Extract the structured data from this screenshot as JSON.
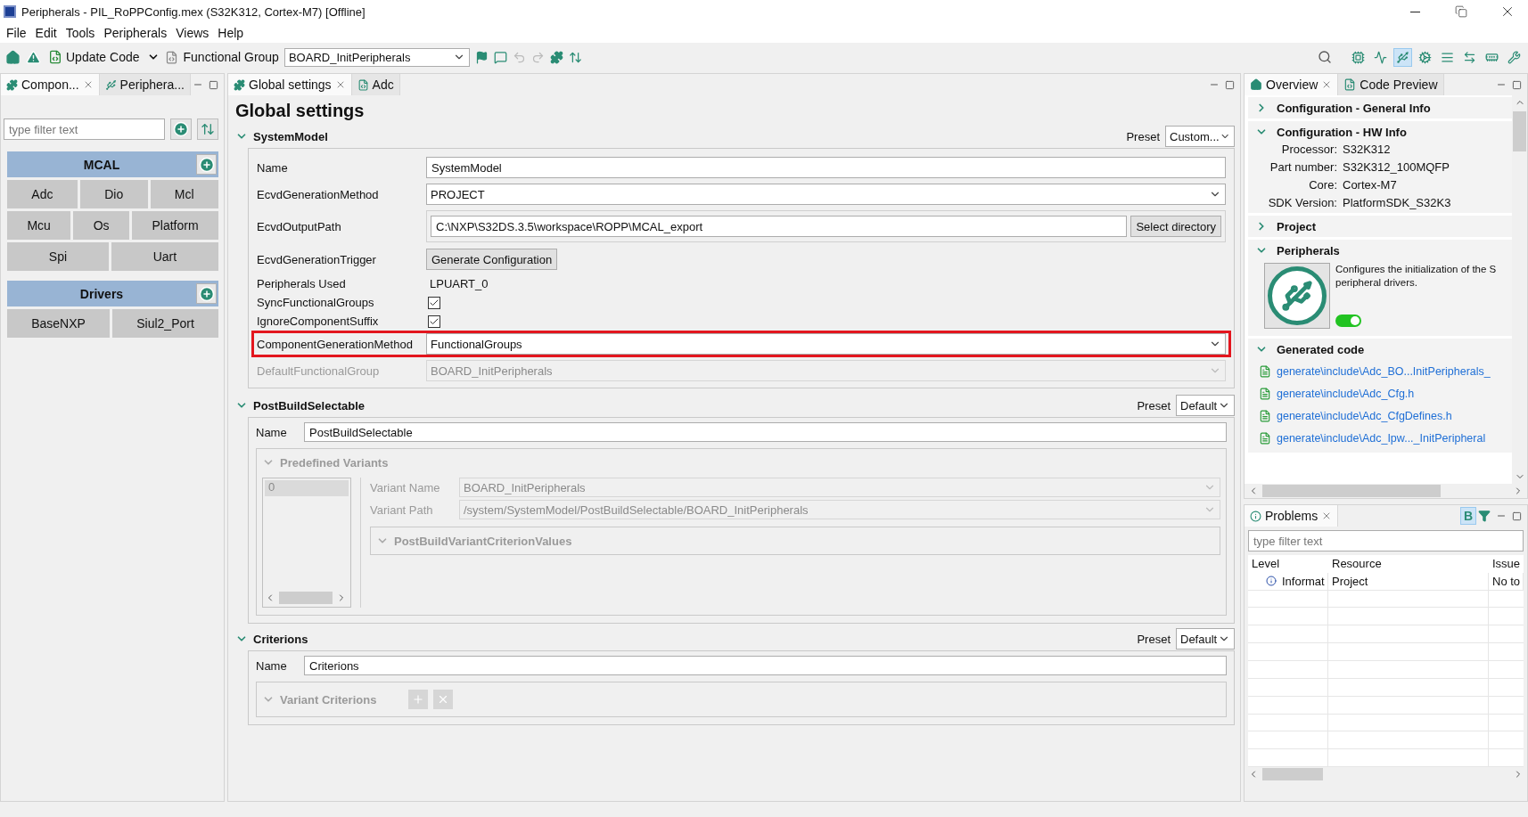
{
  "window": {
    "title": "Peripherals - PIL_RoPPConfig.mex (S32K312, Cortex-M7) [Offline]"
  },
  "menu": [
    "File",
    "Edit",
    "Tools",
    "Peripherals",
    "Views",
    "Help"
  ],
  "toolbar": {
    "update_code": "Update Code",
    "functional_group_label": "Functional Group",
    "functional_group": "BOARD_InitPeripherals",
    "perspectives": [
      {
        "selected": false
      },
      {
        "selected": false
      },
      {
        "selected": true
      },
      {
        "selected": false
      },
      {
        "selected": false
      },
      {
        "selected": false
      },
      {
        "selected": false
      },
      {
        "selected": false
      }
    ]
  },
  "components_panel": {
    "tabs": [
      {
        "label": "Compon...",
        "selected": true
      },
      {
        "label": "Periphera...",
        "selected": false
      }
    ],
    "filter": {
      "placeholder": "type filter text"
    },
    "groups": [
      {
        "title": "MCAL",
        "rows": [
          [
            "Adc",
            "Dio",
            "Mcl"
          ],
          [
            "Mcu",
            "Os",
            "Platform"
          ],
          [
            "Spi",
            "Uart"
          ]
        ]
      },
      {
        "title": "Drivers",
        "rows": [
          [
            "BaseNXP",
            "Siul2_Port"
          ]
        ]
      }
    ]
  },
  "editor": {
    "tabs": [
      {
        "label": "Global settings",
        "selected": true
      },
      {
        "label": "Adc",
        "selected": false
      }
    ],
    "title": "Global settings",
    "system_model": {
      "title": "SystemModel",
      "expanded": true,
      "preset_label": "Preset",
      "preset": "Custom...",
      "fields": [
        {
          "label": "Name",
          "kind": "text",
          "value": "SystemModel",
          "highlighted": false,
          "disabled": false
        },
        {
          "label": "EcvdGenerationMethod",
          "kind": "select",
          "value": "PROJECT",
          "highlighted": false,
          "disabled": false
        },
        {
          "label": "EcvdOutputPath",
          "kind": "path",
          "value": "C:\\NXP\\S32DS.3.5\\workspace\\ROPP\\MCAL_export",
          "button": "Select directory",
          "highlighted": false,
          "disabled": false
        },
        {
          "label": "EcvdGenerationTrigger",
          "kind": "button",
          "button": "Generate Configuration",
          "highlighted": false,
          "disabled": false
        },
        {
          "label": "Peripherals Used",
          "kind": "static",
          "value": "LPUART_0",
          "highlighted": false,
          "disabled": false
        },
        {
          "label": "SyncFunctionalGroups",
          "kind": "checkbox",
          "checked": true,
          "highlighted": false,
          "disabled": false
        },
        {
          "label": "IgnoreComponentSuffix",
          "kind": "checkbox",
          "checked": true,
          "highlighted": false,
          "disabled": false
        },
        {
          "label": "ComponentGenerationMethod",
          "kind": "select",
          "value": "FunctionalGroups",
          "highlighted": true,
          "disabled": false
        },
        {
          "label": "DefaultFunctionalGroup",
          "kind": "select",
          "value": "BOARD_InitPeripherals",
          "highlighted": false,
          "disabled": true
        }
      ]
    },
    "post_build": {
      "title": "PostBuildSelectable",
      "expanded": true,
      "preset_label": "Preset",
      "preset": "Default",
      "name_label": "Name",
      "name": "PostBuildSelectable",
      "variants": {
        "title": "Predefined Variants",
        "expanded": true,
        "items": [
          {
            "label": "0",
            "selected": true
          }
        ],
        "fields": [
          {
            "label": "Variant Name",
            "value": "BOARD_InitPeripherals"
          },
          {
            "label": "Variant Path",
            "value": "/system/SystemModel/PostBuildSelectable/BOARD_InitPeripherals"
          }
        ],
        "subsection": {
          "title": "PostBuildVariantCriterionValues",
          "expanded": true
        }
      }
    },
    "criterions": {
      "title": "Criterions",
      "expanded": true,
      "preset_label": "Preset",
      "preset": "Default",
      "name_label": "Name",
      "name": "Criterions",
      "variant_criteria": {
        "title": "Variant Criterions",
        "expanded": true
      }
    }
  },
  "overview": {
    "tabs": [
      {
        "label": "Overview",
        "selected": true
      },
      {
        "label": "Code Preview",
        "selected": false
      }
    ],
    "sections": [
      {
        "title": "Configuration - General Info",
        "expanded": false
      },
      {
        "title": "Configuration - HW Info",
        "kind": "info",
        "expanded": true,
        "rows": [
          {
            "label": "Processor:",
            "value": "S32K312"
          },
          {
            "label": "Part number:",
            "value": "S32K312_100MQFP"
          },
          {
            "label": "Core:",
            "value": "Cortex-M7"
          },
          {
            "label": "SDK Version:",
            "value": "PlatformSDK_S32K3"
          }
        ]
      },
      {
        "title": "Project",
        "expanded": false
      },
      {
        "title": "Peripherals",
        "kind": "tool",
        "expanded": true,
        "description": [
          "Configures the initialization of the S",
          "peripheral drivers."
        ],
        "enabled": true
      },
      {
        "title": "Generated code",
        "kind": "files",
        "expanded": true,
        "files": [
          "generate\\include\\Adc_BO...InitPeripherals_",
          "generate\\include\\Adc_Cfg.h",
          "generate\\include\\Adc_CfgDefines.h",
          "generate\\include\\Adc_Ipw..._InitPeripheral"
        ]
      }
    ]
  },
  "problems": {
    "tab": "Problems",
    "group_toggle": {
      "label": "B",
      "selected": true
    },
    "filter": {
      "placeholder": "type filter text"
    },
    "columns": [
      "Level",
      "Resource",
      "Issue"
    ],
    "rows": [
      {
        "level": "Informat",
        "resource": "Project",
        "issue": "No to"
      }
    ]
  }
}
